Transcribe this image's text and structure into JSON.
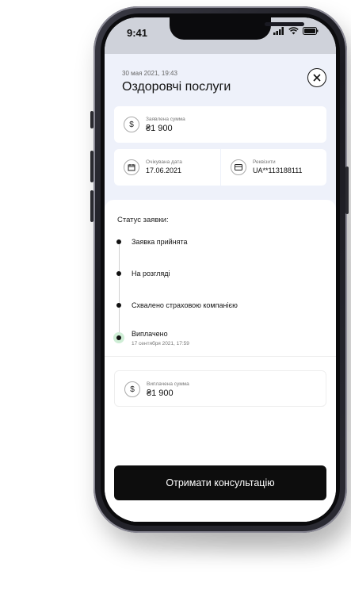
{
  "status_bar": {
    "time": "9:41",
    "signal_icon": "signal-icon",
    "wifi_icon": "wifi-icon",
    "battery_icon": "battery-icon"
  },
  "header": {
    "date": "30 мая 2021, 19:43",
    "title": "Оздоровчі послуги",
    "close_icon": "close-icon"
  },
  "claimed_amount": {
    "label": "Заявлена сумма",
    "value": "₴1 900",
    "icon": "dollar-icon"
  },
  "expected_date": {
    "label": "Очікувана дата",
    "value": "17.06.2021",
    "icon": "calendar-icon"
  },
  "requisites": {
    "label": "Реквізити",
    "value": "UA**113188111",
    "icon": "card-icon"
  },
  "status": {
    "title": "Статус заявки:",
    "steps": [
      {
        "label": "Заявка прийнята"
      },
      {
        "label": "На розгляді"
      },
      {
        "label": "Схвалено страховою компанією"
      },
      {
        "label": "Виплачено",
        "sub": "17 сентября 2021, 17:59"
      }
    ]
  },
  "paid_amount": {
    "label": "Виплачена сумма",
    "value": "₴1 900",
    "icon": "dollar-icon"
  },
  "cta": {
    "label": "Отримати консультацію"
  },
  "colors": {
    "accent": "#0d0d0d",
    "header_bg": "#eef1fa",
    "done_ring": "#cfeed6"
  }
}
